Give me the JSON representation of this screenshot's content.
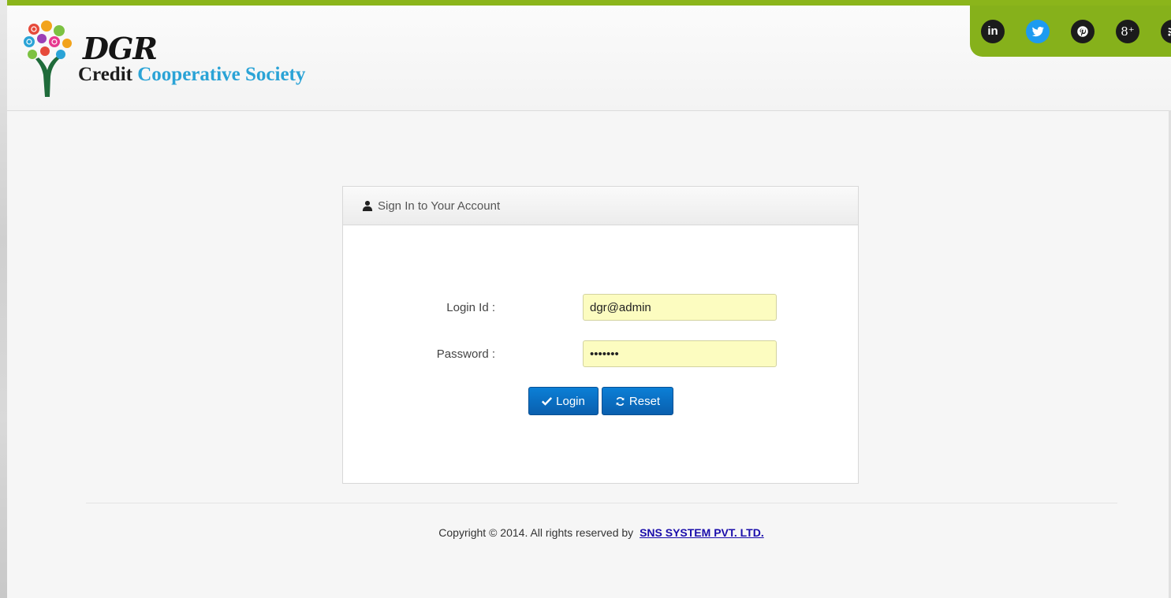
{
  "header": {
    "brand_name": "DGR",
    "brand_sub_1": "Credit",
    "brand_sub_2": "Cooperative Society"
  },
  "social": {
    "icons": [
      "linkedin-icon",
      "twitter-icon",
      "pinterest-icon",
      "google-plus-icon",
      "rss-icon"
    ],
    "linkedin_label": "in",
    "gplus_label": "8⁺"
  },
  "login_panel": {
    "title": "Sign In to Your Account",
    "login_id_label": "Login Id :",
    "login_id_value": "dgr@admin",
    "password_label": "Password :",
    "password_value": "•••••••",
    "login_button": "Login",
    "reset_button": "Reset"
  },
  "footer": {
    "copyright_text": "Copyright © 2014. All rights reserved by",
    "company_link": "SNS SYSTEM PVT. LTD."
  },
  "colors": {
    "accent_green": "#86b11b",
    "brand_blue": "#2aa3d6",
    "button_blue": "#0a6cc2",
    "input_bg": "#fcfcc0"
  }
}
